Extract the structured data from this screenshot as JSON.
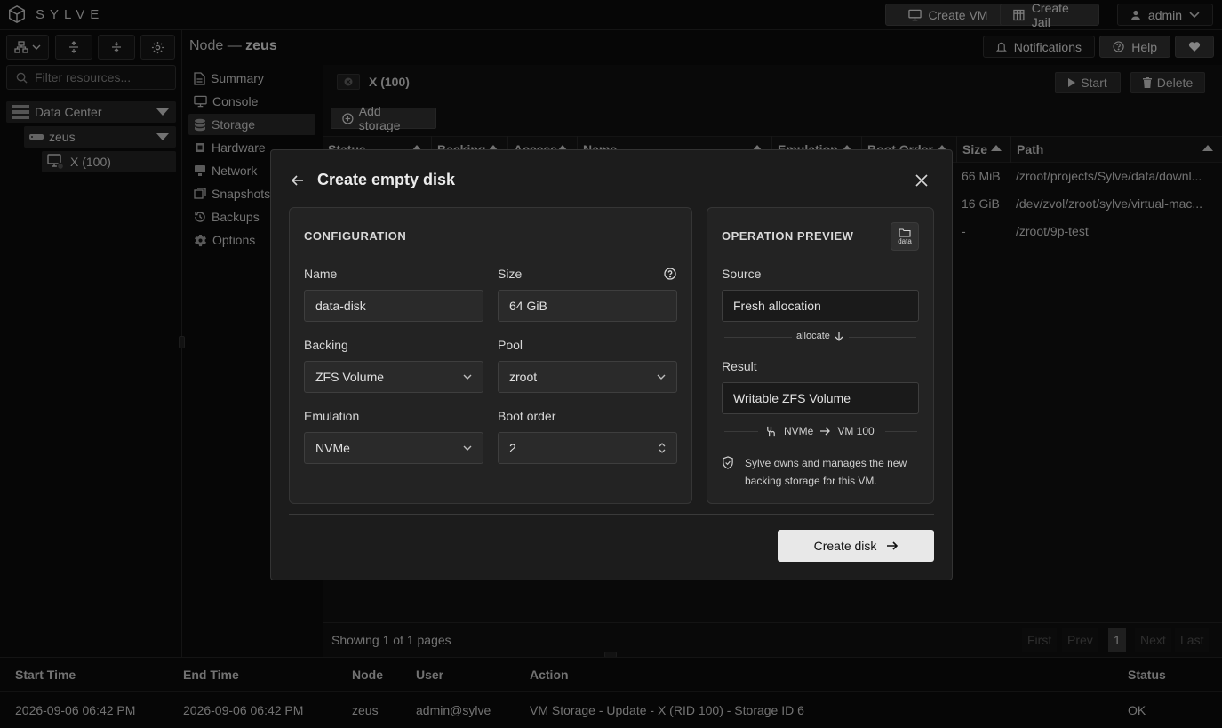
{
  "app": {
    "name": "SYLVE"
  },
  "topbar": {
    "create_vm": "Create VM",
    "create_jail": "Create Jail",
    "user": "admin"
  },
  "left": {
    "filter_placeholder": "Filter resources...",
    "tree": {
      "datacenter": "Data Center",
      "node": "zeus",
      "vm": "X (100)"
    }
  },
  "breadcrumb": {
    "prefix": "Node —",
    "node": "zeus"
  },
  "header_right": {
    "notifications": "Notifications",
    "help": "Help"
  },
  "nav": [
    "Summary",
    "Console",
    "Storage",
    "Hardware",
    "Network",
    "Snapshots",
    "Backups",
    "Options"
  ],
  "main": {
    "tab": "X (100)",
    "start": "Start",
    "delete": "Delete",
    "add_storage": "Add storage",
    "columns": [
      "Status",
      "Backing",
      "Access",
      "Name",
      "Emulation",
      "Boot Order",
      "Size",
      "Path"
    ],
    "rows": [
      {
        "size": "66 MiB",
        "path": "/zroot/projects/Sylve/data/downl..."
      },
      {
        "size": "16 GiB",
        "path": "/dev/zvol/zroot/sylve/virtual-mac..."
      },
      {
        "size": "-",
        "path": "/zroot/9p-test"
      }
    ],
    "footer": "Showing 1 of 1 pages",
    "pagination": {
      "first": "First",
      "prev": "Prev",
      "page": "1",
      "next": "Next",
      "last": "Last"
    }
  },
  "bottom": {
    "headers": [
      "Start Time",
      "End Time",
      "Node",
      "User",
      "Action",
      "Status"
    ],
    "row": {
      "start": "2026-09-06 06:42 PM",
      "end": "2026-09-06 06:42 PM",
      "node": "zeus",
      "user": "admin@sylve",
      "action": "VM Storage - Update - X (RID 100) - Storage ID 6",
      "status": "OK"
    }
  },
  "modal": {
    "title": "Create empty disk",
    "config": {
      "header": "CONFIGURATION",
      "name_label": "Name",
      "name_value": "data-disk",
      "size_label": "Size",
      "size_value": "64 GiB",
      "backing_label": "Backing",
      "backing_value": "ZFS Volume",
      "pool_label": "Pool",
      "pool_value": "zroot",
      "emulation_label": "Emulation",
      "emulation_value": "NVMe",
      "boot_label": "Boot order",
      "boot_value": "2"
    },
    "preview": {
      "header": "OPERATION PREVIEW",
      "icon_label": "data",
      "source_label": "Source",
      "source_value": "Fresh allocation",
      "allocate": "allocate",
      "result_label": "Result",
      "result_value": "Writable ZFS Volume",
      "flow_from": "NVMe",
      "flow_to": "VM 100",
      "note": "Sylve owns and manages the new backing storage for this VM."
    },
    "create_button": "Create disk"
  }
}
